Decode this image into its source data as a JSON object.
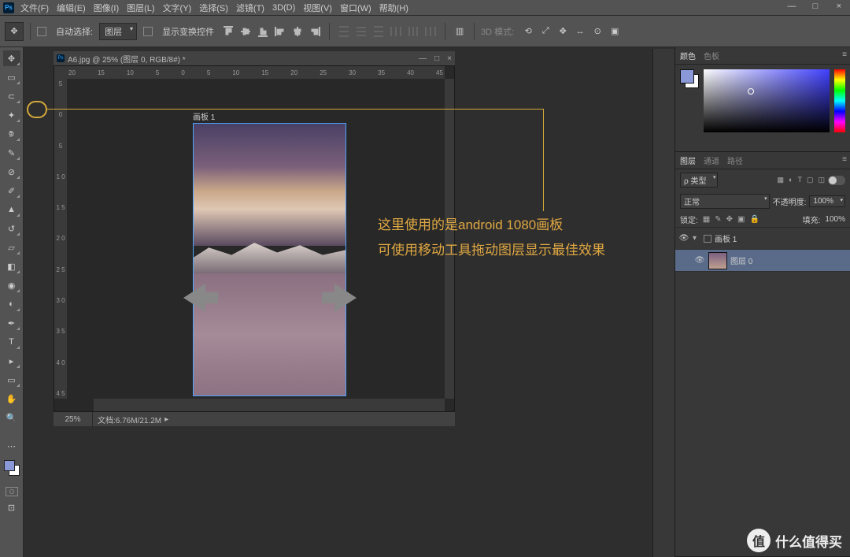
{
  "menu": {
    "items": [
      "文件(F)",
      "编辑(E)",
      "图像(I)",
      "图层(L)",
      "文字(Y)",
      "选择(S)",
      "滤镜(T)",
      "3D(D)",
      "视图(V)",
      "窗口(W)",
      "帮助(H)"
    ]
  },
  "options": {
    "auto_select": "自动选择:",
    "layer_dd": "图层",
    "show_transform": "显示变换控件",
    "mode3d_label": "3D 模式:"
  },
  "document": {
    "tab_title": "A6.jpg @ 25% (图层 0, RGB/8#) *",
    "artboard_label": "画板 1",
    "ruler_h": [
      "20",
      "15",
      "10",
      "5",
      "0",
      "5",
      "10",
      "15",
      "20",
      "25",
      "30",
      "35",
      "40",
      "45"
    ],
    "ruler_v": [
      "5",
      "0",
      "5",
      "1 0",
      "1 5",
      "2 0",
      "2 5",
      "3 0",
      "3 5",
      "4 0",
      "4 5"
    ],
    "zoom": "25%",
    "docinfo": "文档:6.76M/21.2M"
  },
  "annotation": {
    "line1": "这里使用的是android 1080画板",
    "line2": "可使用移动工具拖动图层显示最佳效果"
  },
  "panels": {
    "color": {
      "tabs": [
        "颜色",
        "色板"
      ]
    },
    "layers": {
      "tabs": [
        "图层",
        "通道",
        "路径"
      ],
      "kind_dd": "ρ 类型",
      "blend_dd": "正常",
      "opacity_label": "不透明度:",
      "opacity_val": "100%",
      "lock_label": "锁定:",
      "fill_label": "填充:",
      "fill_val": "100%",
      "items": [
        {
          "name": "画板 1",
          "artboard": true
        },
        {
          "name": "图层 0",
          "selected": true
        }
      ]
    }
  },
  "watermark": "什么值得买"
}
